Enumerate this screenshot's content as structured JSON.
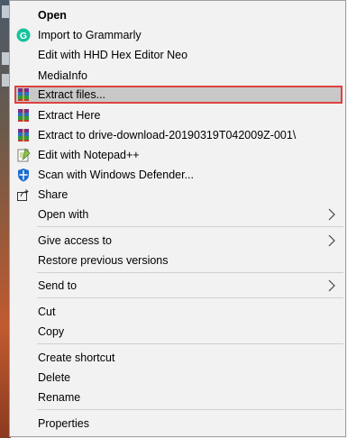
{
  "menu": {
    "items": [
      {
        "label": "Open",
        "icon": "none",
        "bold": true
      },
      {
        "label": "Import to Grammarly",
        "icon": "grammarly-icon"
      },
      {
        "label": "Edit with HHD Hex Editor Neo",
        "icon": "none"
      },
      {
        "label": "MediaInfo",
        "icon": "none"
      },
      {
        "label": "Extract files...",
        "icon": "winrar-icon",
        "highlighted": true
      },
      {
        "label": "Extract Here",
        "icon": "winrar-icon"
      },
      {
        "label": "Extract to drive-download-20190319T042009Z-001\\",
        "icon": "winrar-icon"
      },
      {
        "label": "Edit with Notepad++",
        "icon": "notepadpp-icon"
      },
      {
        "label": "Scan with Windows Defender...",
        "icon": "windows-defender-icon"
      },
      {
        "label": "Share",
        "icon": "share-icon"
      },
      {
        "label": "Open with",
        "icon": "none",
        "submenu": true
      },
      {
        "label": "Give access to",
        "icon": "none",
        "submenu": true
      },
      {
        "label": "Restore previous versions",
        "icon": "none"
      },
      {
        "label": "Send to",
        "icon": "none",
        "submenu": true
      },
      {
        "label": "Cut",
        "icon": "none"
      },
      {
        "label": "Copy",
        "icon": "none"
      },
      {
        "label": "Create shortcut",
        "icon": "none"
      },
      {
        "label": "Delete",
        "icon": "none"
      },
      {
        "label": "Rename",
        "icon": "none"
      },
      {
        "label": "Properties",
        "icon": "none"
      }
    ]
  },
  "colors": {
    "highlight_border": "#e04040",
    "highlight_fill": "#c8c8c8",
    "grammarly": "#15c39a"
  }
}
